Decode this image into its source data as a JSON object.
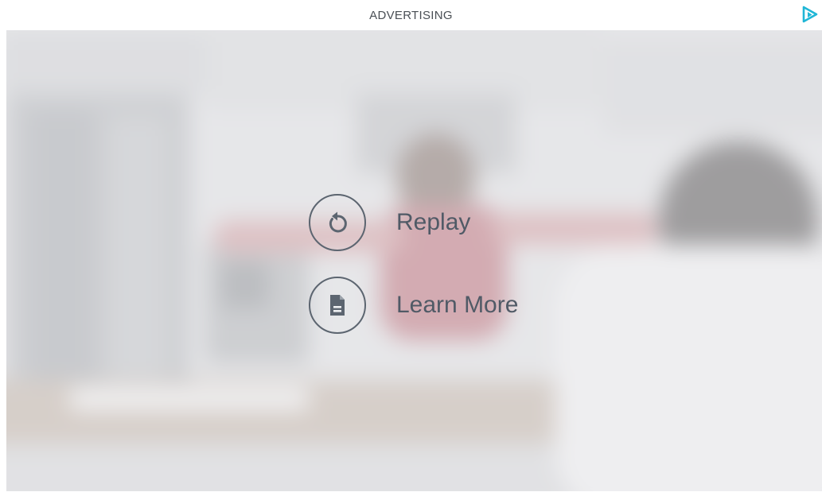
{
  "header": {
    "label": "ADVERTISING",
    "brand_icon": "play-logo-icon",
    "brand_color": "#1fb6d6"
  },
  "end_screen": {
    "items": [
      {
        "label": "Replay",
        "icon": "replay-icon"
      },
      {
        "label": "Learn More",
        "icon": "document-icon"
      }
    ],
    "icon_color": "#5c6570",
    "text_color": "#505a66"
  }
}
